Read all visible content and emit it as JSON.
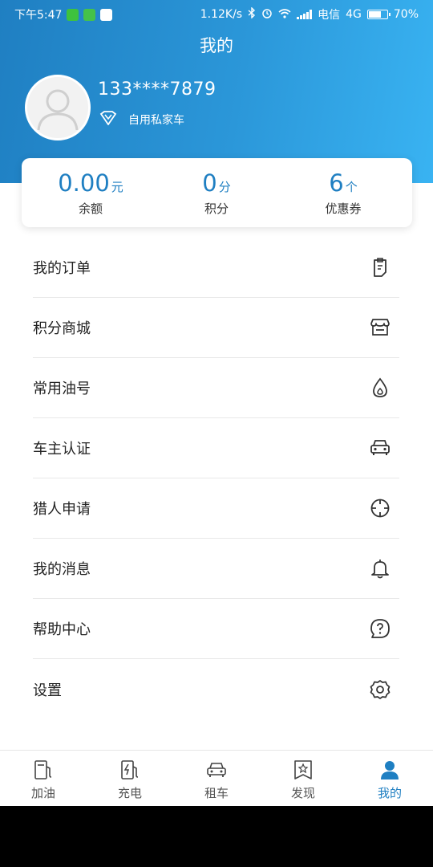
{
  "status_bar": {
    "time": "下午5:47",
    "speed": "1.12K/s",
    "carrier": "电信",
    "network": "4G",
    "battery": "70%",
    "battery_level": 0.7
  },
  "header": {
    "title": "我的",
    "phone": "133****7879",
    "vip_label": "自用私家车"
  },
  "stats": [
    {
      "value": "0.00",
      "unit": "元",
      "label": "余额"
    },
    {
      "value": "0",
      "unit": "分",
      "label": "积分"
    },
    {
      "value": "6",
      "unit": "个",
      "label": "优惠券"
    }
  ],
  "menu": [
    {
      "label": "我的订单",
      "icon": "order-icon"
    },
    {
      "label": "积分商城",
      "icon": "store-icon"
    },
    {
      "label": "常用油号",
      "icon": "oil-drop-icon"
    },
    {
      "label": "车主认证",
      "icon": "car-icon"
    },
    {
      "label": "猎人申请",
      "icon": "crosshair-icon"
    },
    {
      "label": "我的消息",
      "icon": "bell-icon"
    },
    {
      "label": "帮助中心",
      "icon": "help-icon"
    },
    {
      "label": "设置",
      "icon": "gear-icon"
    }
  ],
  "tabs": [
    {
      "label": "加油",
      "icon": "fuel-pump-icon"
    },
    {
      "label": "充电",
      "icon": "charging-icon"
    },
    {
      "label": "租车",
      "icon": "car-icon"
    },
    {
      "label": "发现",
      "icon": "bookmark-star-icon"
    },
    {
      "label": "我的",
      "icon": "person-icon",
      "active": true
    }
  ],
  "colors": {
    "accent": "#1f7fc2",
    "header_gradient_start": "#1f7fc2",
    "header_gradient_end": "#39b3f2"
  }
}
